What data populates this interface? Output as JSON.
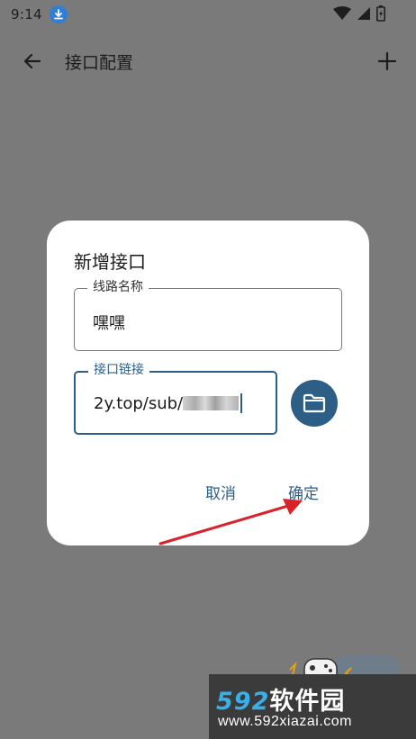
{
  "status_bar": {
    "time": "9:14"
  },
  "app_bar": {
    "title": "接口配置"
  },
  "dialog": {
    "title": "新增接口",
    "name_field": {
      "label": "线路名称",
      "value": "嘿嘿"
    },
    "url_field": {
      "label": "接口链接",
      "value": "2y.top/sub/"
    },
    "cancel_label": "取消",
    "ok_label": "确定"
  },
  "watermark": {
    "logo_digits": "592",
    "logo_text": "软件园",
    "url": "www.592xiazai.com"
  },
  "colors": {
    "accent": "#2c5e86",
    "scrim": "#7a7a7a",
    "annotation_arrow": "#d9232a"
  }
}
